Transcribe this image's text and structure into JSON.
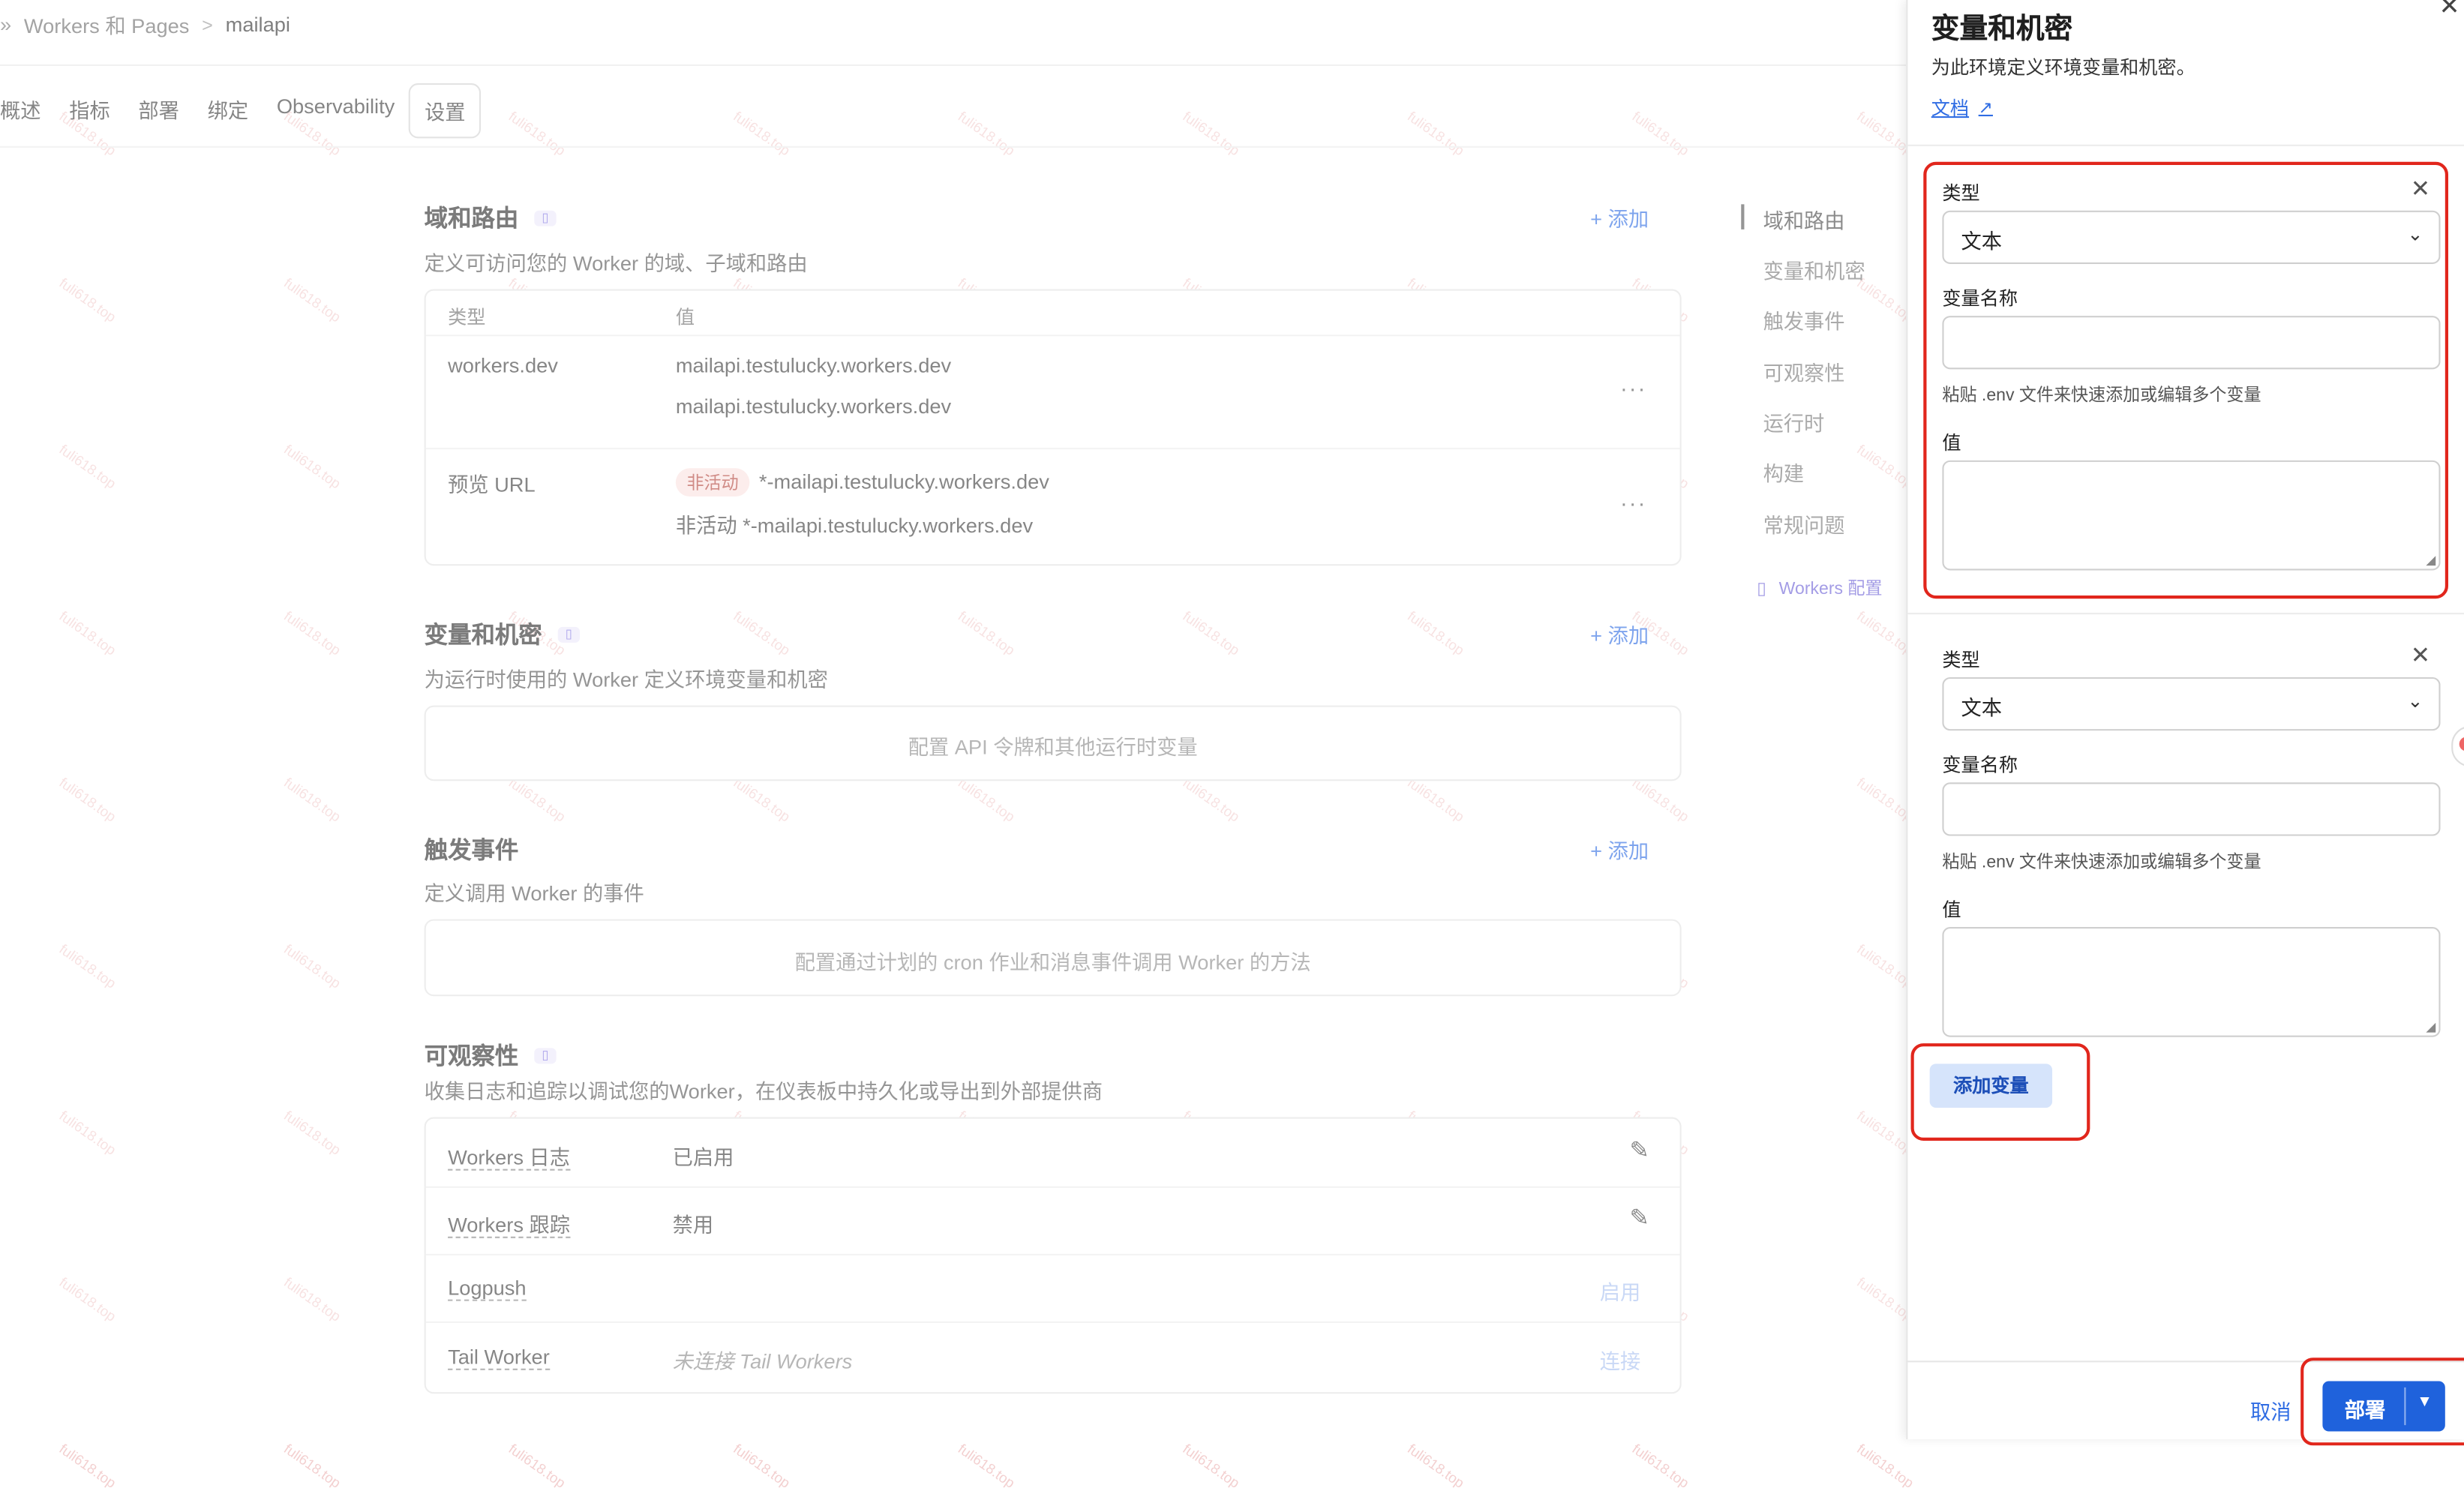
{
  "breadcrumb": {
    "parent": "Workers 和 Pages",
    "separator": ">",
    "current": "mailapi"
  },
  "tabs": [
    {
      "label": "概述"
    },
    {
      "label": "指标"
    },
    {
      "label": "部署"
    },
    {
      "label": "绑定"
    },
    {
      "label": "Observability"
    },
    {
      "label": "设置",
      "active": true
    }
  ],
  "domains": {
    "title": "域和路由",
    "desc": "定义可访问您的 Worker 的域、子域和路由",
    "add": "+ 添加",
    "col_type": "类型",
    "col_value": "值",
    "rows": [
      {
        "type": "workers.dev",
        "line1": "mailapi.testulucky.workers.dev",
        "line2": "mailapi.testulucky.workers.dev"
      },
      {
        "type": "预览 URL",
        "badge": "非活动",
        "line1": "*-mailapi.testulucky.workers.dev",
        "line2": "非活动 *-mailapi.testulucky.workers.dev"
      }
    ],
    "more": "···"
  },
  "variables": {
    "title": "变量和机密",
    "desc": "为运行时使用的 Worker 定义环境变量和机密",
    "add": "+ 添加",
    "placeholder": "配置 API 令牌和其他运行时变量"
  },
  "triggers": {
    "title": "触发事件",
    "desc": "定义调用 Worker 的事件",
    "add": "+ 添加",
    "placeholder": "配置通过计划的 cron 作业和消息事件调用 Worker 的方法"
  },
  "observability": {
    "title": "可观察性",
    "desc": "收集日志和追踪以调试您的Worker，在仪表板中持久化或导出到外部提供商",
    "rows": [
      {
        "name": "Workers 日志",
        "value": "已启用",
        "action": "edit-icon"
      },
      {
        "name": "Workers 跟踪",
        "value": "禁用",
        "action": "edit-icon"
      },
      {
        "name": "Logpush",
        "value": "",
        "action_text": "启用"
      },
      {
        "name": "Tail Worker",
        "value": "未连接 Tail Workers",
        "action_text": "连接"
      }
    ]
  },
  "right_nav": {
    "items": [
      "域和路由",
      "变量和机密",
      "触发事件",
      "可观察性",
      "运行时",
      "构建",
      "常规问题"
    ],
    "doc_link": "Workers 配置"
  },
  "watermark": "fuli618.top",
  "panel": {
    "title": "变量和机密",
    "desc": "为此环境定义环境变量和机密。",
    "doc": "文档",
    "entries": [
      {
        "type_label": "类型",
        "type_value": "文本",
        "name_label": "变量名称",
        "name_value": "",
        "hint": "粘贴 .env 文件来快速添加或编辑多个变量",
        "value_label": "值",
        "value": ""
      },
      {
        "type_label": "类型",
        "type_value": "文本",
        "name_label": "变量名称",
        "name_value": "",
        "hint": "粘贴 .env 文件来快速添加或编辑多个变量",
        "value_label": "值",
        "value": ""
      }
    ],
    "add_variable": "添加变量",
    "cancel": "取消",
    "deploy": "部署"
  }
}
